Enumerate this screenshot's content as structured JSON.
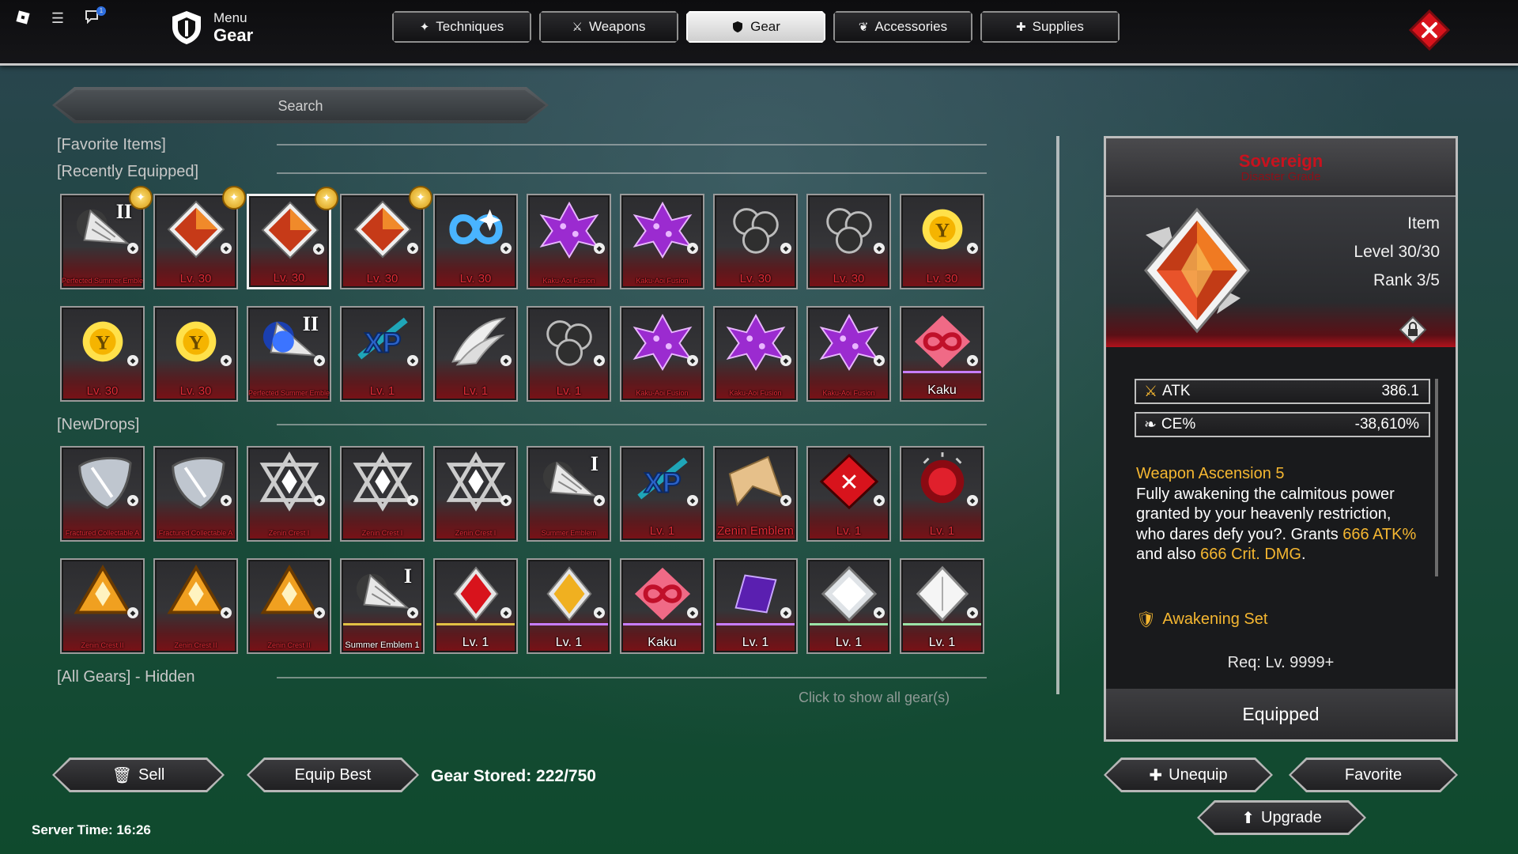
{
  "topbar": {
    "menu_label": "Menu",
    "title": "Gear",
    "notification_count": "1",
    "tabs": [
      {
        "label": "Techniques",
        "icon": "sparkle-icon",
        "active": false
      },
      {
        "label": "Weapons",
        "icon": "crossed-swords-icon",
        "active": false
      },
      {
        "label": "Gear",
        "icon": "shield-icon",
        "active": true
      },
      {
        "label": "Accessories",
        "icon": "accessory-icon",
        "active": false
      },
      {
        "label": "Supplies",
        "icon": "medkit-icon",
        "active": false
      }
    ]
  },
  "search": {
    "placeholder": "Search"
  },
  "sections": {
    "favorite": "[Favorite Items]",
    "recent": "[Recently Equipped]",
    "new_drops": "[NewDrops]",
    "all_gears": "[All Gears] - Hidden",
    "show_all": "Click to show all gear(s)"
  },
  "recent_rows": [
    [
      {
        "label": "Perfected Summer Emblem",
        "art": "drill",
        "roman": "II",
        "fav": true
      },
      {
        "label": "Lv. 30",
        "art": "orange-gem",
        "fav": true
      },
      {
        "label": "Lv. 30",
        "art": "orange-gem",
        "fav": true,
        "selected": true
      },
      {
        "label": "Lv. 30",
        "art": "orange-gem",
        "fav": true
      },
      {
        "label": "Lv. 30",
        "art": "infinity"
      },
      {
        "label": "Kaku-Aoi Fusion",
        "art": "purple-cross"
      },
      {
        "label": "Kaku-Aoi Fusion",
        "art": "purple-cross"
      },
      {
        "label": "Lv. 30",
        "art": "triple-orb"
      },
      {
        "label": "Lv. 30",
        "art": "triple-orb"
      },
      {
        "label": "Lv. 30",
        "art": "sun-y"
      }
    ],
    [
      {
        "label": "Lv. 30",
        "art": "sun-y"
      },
      {
        "label": "Lv. 30",
        "art": "sun-y"
      },
      {
        "label": "Perfected Summer Emblem",
        "art": "blue-drill",
        "roman": "II"
      },
      {
        "label": "Lv. 1",
        "art": "xp"
      },
      {
        "label": "Lv. 1",
        "art": "wings"
      },
      {
        "label": "Lv. 1",
        "art": "triple-orb"
      },
      {
        "label": "Kaku-Aoi Fusion",
        "art": "purple-cross"
      },
      {
        "label": "Kaku-Aoi Fusion",
        "art": "purple-cross"
      },
      {
        "label": "Kaku-Aoi Fusion",
        "art": "purple-cross"
      },
      {
        "label": "Kaku",
        "art": "pink-infinity",
        "white": true,
        "stripe": "#c77dff"
      }
    ]
  ],
  "drop_rows": [
    [
      {
        "label": "Fractured Collectable A",
        "art": "silver-shard"
      },
      {
        "label": "Fractured Collectable A",
        "art": "silver-shard"
      },
      {
        "label": "Zenin Crest I",
        "art": "hex-star"
      },
      {
        "label": "Zenin Crest I",
        "art": "hex-star"
      },
      {
        "label": "Zenin Crest I",
        "art": "hex-star"
      },
      {
        "label": "Summer Emblem",
        "art": "drill",
        "roman": "I"
      },
      {
        "label": "Lv. 1",
        "art": "xp"
      },
      {
        "label": "Zenin Emblem",
        "art": "tan-shard"
      },
      {
        "label": "Lv. 1",
        "art": "red-diamond"
      },
      {
        "label": "Lv. 1",
        "art": "red-orb"
      }
    ],
    [
      {
        "label": "Zenin Crest II",
        "art": "orange-hex"
      },
      {
        "label": "Zenin Crest II",
        "art": "orange-hex"
      },
      {
        "label": "Zenin Crest II",
        "art": "orange-hex"
      },
      {
        "label": "Summer Emblem 1",
        "art": "drill",
        "roman": "I",
        "white": true,
        "stripe": "#e2c044"
      },
      {
        "label": "Lv. 1",
        "art": "red-gem",
        "white": true,
        "stripe": "#e2c044"
      },
      {
        "label": "Lv. 1",
        "art": "gold-gem",
        "white": true,
        "stripe": "#c77dff"
      },
      {
        "label": "Kaku",
        "art": "pink-infinity",
        "white": true,
        "stripe": "#c77dff"
      },
      {
        "label": "Lv. 1",
        "art": "purple-shard",
        "white": true,
        "stripe": "#c77dff"
      },
      {
        "label": "Lv. 1",
        "art": "silver-diamond",
        "white": true,
        "stripe": "#9be3a8"
      },
      {
        "label": "Lv. 1",
        "art": "white-diamond",
        "white": true,
        "stripe": "#9be3a8"
      }
    ]
  ],
  "footer": {
    "sell": "Sell",
    "equip_best": "Equip Best",
    "stored": "Gear Stored: 222/750",
    "server_time": "Server Time: 16:26"
  },
  "details": {
    "name": "Sovereign",
    "grade": "Disaster Grade",
    "type": "Item",
    "level": "Level 30/30",
    "rank": "Rank 3/5",
    "stats": [
      {
        "name": "ATK",
        "icon": "crossed-swords-icon",
        "value": "386.1"
      },
      {
        "name": "CE%",
        "icon": "energy-icon",
        "value": "-38,610%"
      }
    ],
    "desc_title": "Weapon Ascension 5",
    "desc_1": "Fully awakening the calmitous power granted by your heavenly restriction, who dares defy you?. Grants ",
    "desc_atk": "666 ATK%",
    "desc_2": " and also ",
    "desc_crit": "666 Crit. DMG",
    "desc_3": ".",
    "set_name": "Awakening Set",
    "requirement": "Req: Lv. 9999+",
    "status": "Equipped"
  },
  "actions": {
    "unequip": "Unequip",
    "favorite": "Favorite",
    "upgrade": "Upgrade"
  },
  "colors": {
    "accent_red": "#c8121e",
    "gold": "#f5b731",
    "panel": "#191a1c"
  }
}
